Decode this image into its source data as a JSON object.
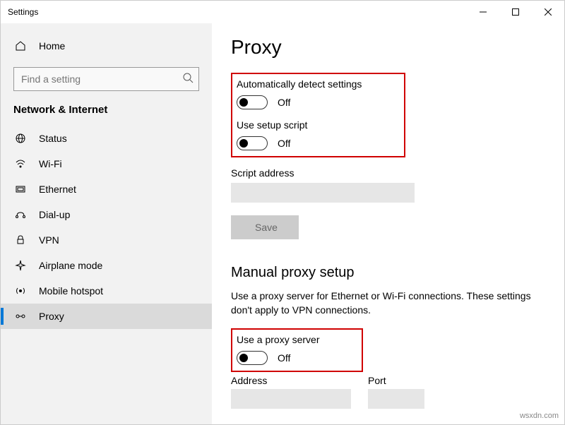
{
  "window": {
    "title": "Settings"
  },
  "sidebar": {
    "home_label": "Home",
    "search_placeholder": "Find a setting",
    "category": "Network & Internet",
    "items": [
      {
        "label": "Status"
      },
      {
        "label": "Wi-Fi"
      },
      {
        "label": "Ethernet"
      },
      {
        "label": "Dial-up"
      },
      {
        "label": "VPN"
      },
      {
        "label": "Airplane mode"
      },
      {
        "label": "Mobile hotspot"
      },
      {
        "label": "Proxy"
      }
    ]
  },
  "page": {
    "title": "Proxy",
    "auto": {
      "detect_label": "Automatically detect settings",
      "detect_state": "Off",
      "script_label": "Use setup script",
      "script_state": "Off",
      "script_addr_label": "Script address",
      "script_addr_value": "",
      "save_label": "Save"
    },
    "manual": {
      "title": "Manual proxy setup",
      "desc": "Use a proxy server for Ethernet or Wi-Fi connections. These settings don't apply to VPN connections.",
      "use_label": "Use a proxy server",
      "use_state": "Off",
      "address_label": "Address",
      "address_value": "",
      "port_label": "Port",
      "port_value": ""
    }
  },
  "watermark": "wsxdn.com"
}
